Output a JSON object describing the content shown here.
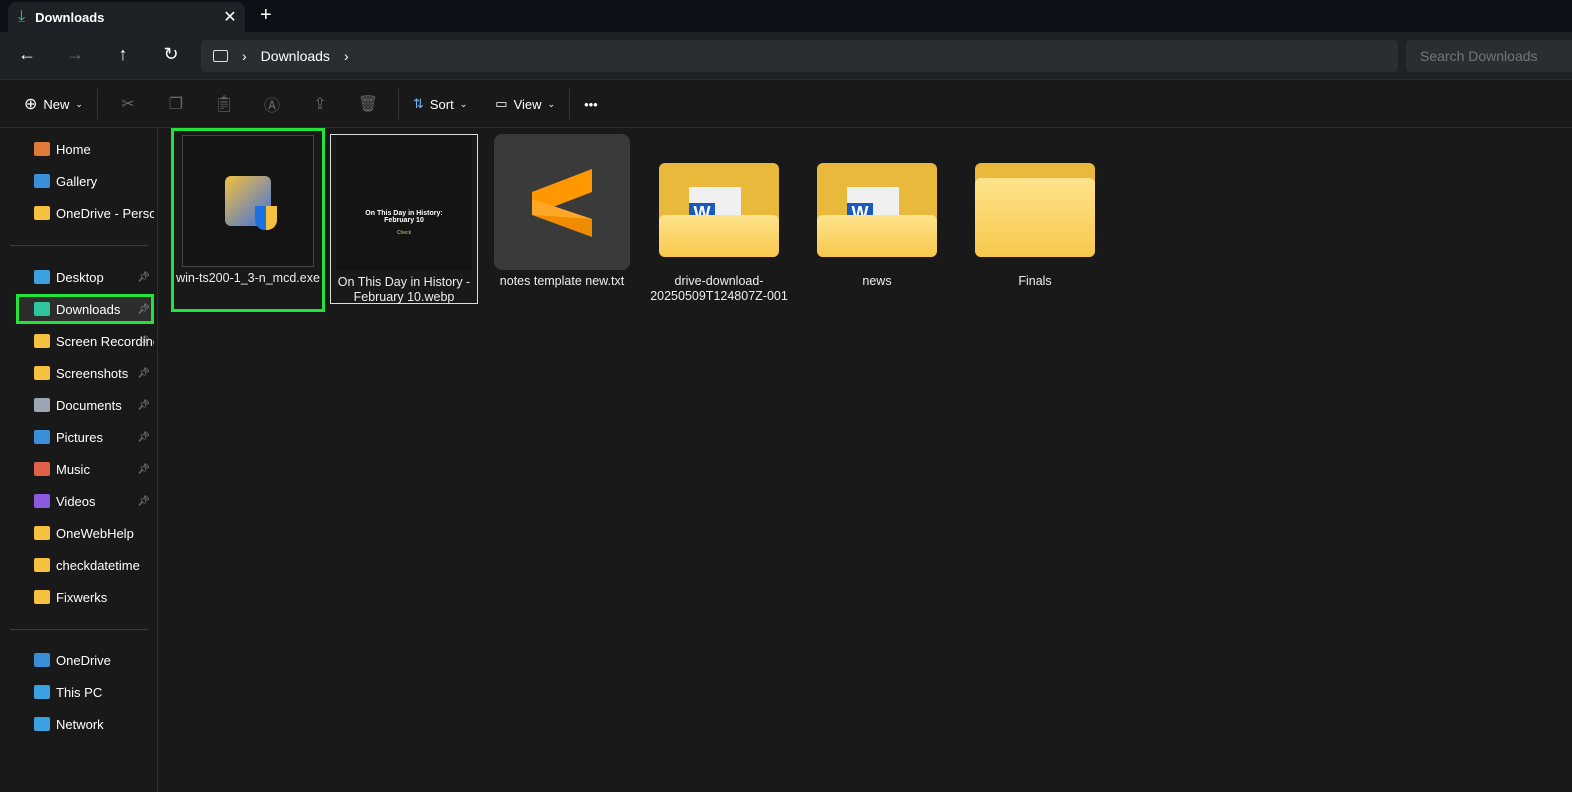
{
  "window": {
    "tab_title": "Downloads",
    "tab_icon": "download-icon",
    "new_tab": "+",
    "close": "✕"
  },
  "address": {
    "crumbs": [
      "Downloads"
    ],
    "search_placeholder": "Search Downloads"
  },
  "toolbar": {
    "new_label": "New",
    "sort_label": "Sort",
    "view_label": "View",
    "more": "•••"
  },
  "sidebar": {
    "top": [
      {
        "label": "Home",
        "color": "#e07a3a"
      },
      {
        "label": "Gallery",
        "color": "#3b8fd9"
      },
      {
        "label": "OneDrive - Personal",
        "color": "#f5c040",
        "expand": true
      }
    ],
    "pinned": [
      {
        "label": "Desktop",
        "color": "#3aa0e0",
        "pin": true
      },
      {
        "label": "Downloads",
        "color": "#2fc4a0",
        "pin": true,
        "selected": true
      },
      {
        "label": "Screen Recordings",
        "color": "#f5c040",
        "pin": true
      },
      {
        "label": "Screenshots",
        "color": "#f5c040",
        "pin": true
      },
      {
        "label": "Documents",
        "color": "#9aa6b4",
        "pin": true
      },
      {
        "label": "Pictures",
        "color": "#3b8fd9",
        "pin": true
      },
      {
        "label": "Music",
        "color": "#e0604a",
        "pin": true
      },
      {
        "label": "Videos",
        "color": "#8a5ae0",
        "pin": true
      },
      {
        "label": "OneWebHelp",
        "color": "#f5c040"
      },
      {
        "label": "checkdatetime",
        "color": "#f5c040"
      },
      {
        "label": "Fixwerks",
        "color": "#f5c040"
      }
    ],
    "bottom": [
      {
        "label": "OneDrive",
        "color": "#3b8fd9"
      },
      {
        "label": "This PC",
        "color": "#3aa0e0"
      },
      {
        "label": "Network",
        "color": "#3aa0e0"
      }
    ]
  },
  "files": [
    {
      "name": "win-ts200-1_3-n_mcd.exe",
      "type": "exe",
      "highlighted": true
    },
    {
      "name": "On This Day in History - February 10.webp",
      "type": "image",
      "thumb_text": "On This Day in History: February 10",
      "thumb_logo": "Check"
    },
    {
      "name": "notes template new.txt",
      "type": "sublime"
    },
    {
      "name": "drive-download-20250509T124807Z-001",
      "type": "folder-word"
    },
    {
      "name": "news",
      "type": "folder-word"
    },
    {
      "name": "Finals",
      "type": "folder"
    }
  ],
  "colors": {
    "highlight": "#22e33a",
    "accent": "#2fc4a0"
  }
}
